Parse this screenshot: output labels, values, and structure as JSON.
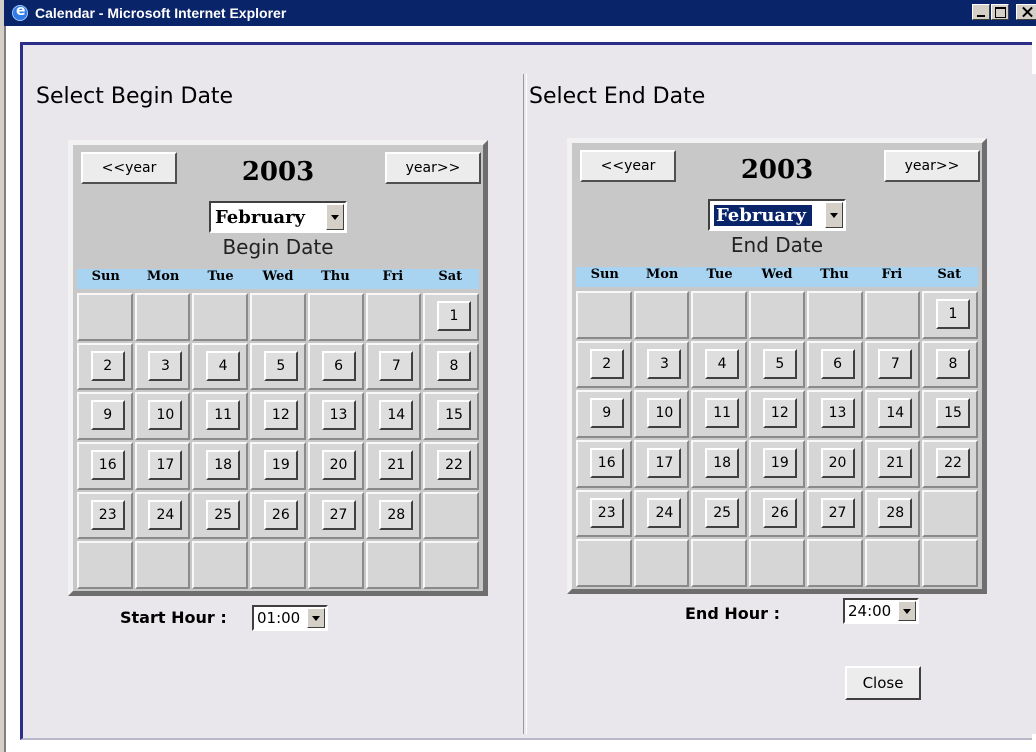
{
  "window": {
    "title": "Calendar - Microsoft Internet Explorer"
  },
  "begin": {
    "heading": "Select Begin Date",
    "prev_year_label": "<<year",
    "next_year_label": "year>>",
    "year": "2003",
    "month": "February",
    "caption": "Begin Date",
    "hour_label": "Start Hour :",
    "hour_value": "01:00"
  },
  "end": {
    "heading": "Select End Date",
    "prev_year_label": "<<year",
    "next_year_label": "year>>",
    "year": "2003",
    "month": "February",
    "caption": "End Date",
    "hour_label": "End Hour :",
    "hour_value": "24:00",
    "close_label": "Close"
  },
  "weekdays": [
    "Sun",
    "Mon",
    "Tue",
    "Wed",
    "Thu",
    "Fri",
    "Sat"
  ],
  "days": [
    "",
    "",
    "",
    "",
    "",
    "",
    "1",
    "2",
    "3",
    "4",
    "5",
    "6",
    "7",
    "8",
    "9",
    "10",
    "11",
    "12",
    "13",
    "14",
    "15",
    "16",
    "17",
    "18",
    "19",
    "20",
    "21",
    "22",
    "23",
    "24",
    "25",
    "26",
    "27",
    "28",
    "",
    "",
    "",
    "",
    "",
    "",
    "",
    ""
  ]
}
